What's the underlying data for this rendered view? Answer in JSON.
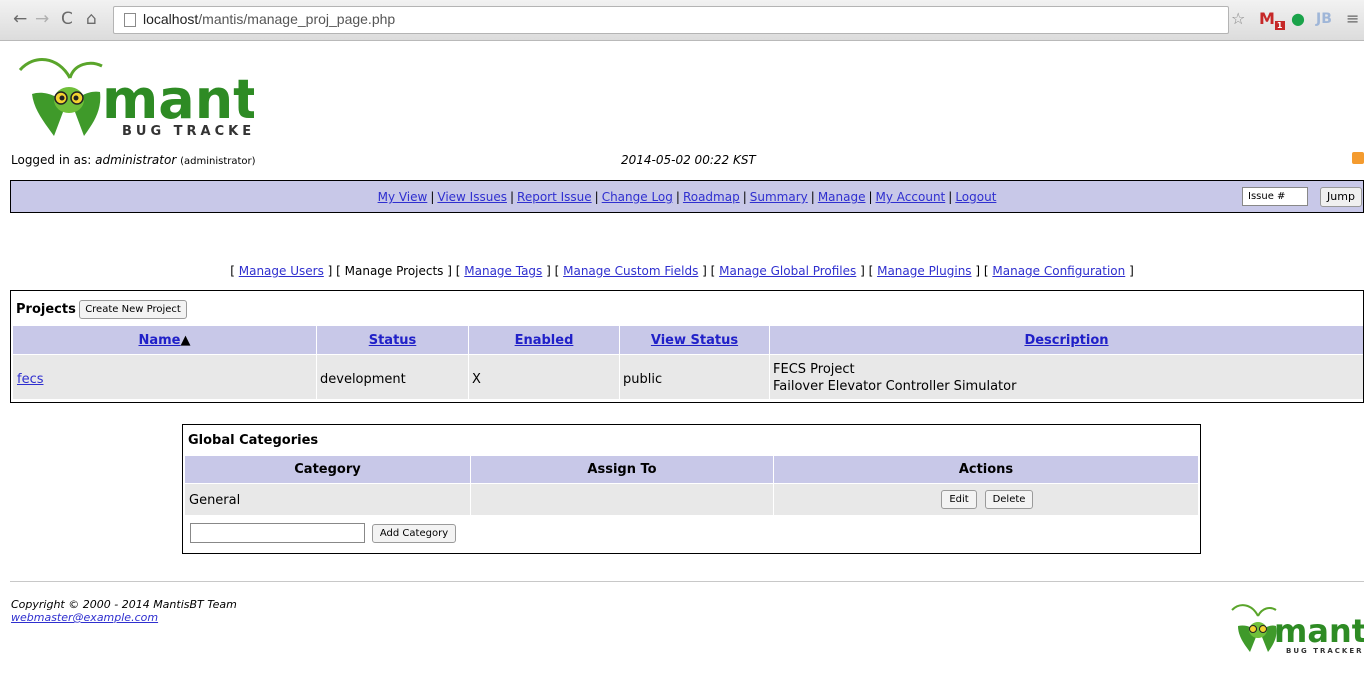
{
  "browser": {
    "url_host": "localhost",
    "url_path": "/mantis/manage_proj_page.php",
    "gmail_badge": "1"
  },
  "logo": {
    "wordmark": "mantis",
    "tagline": "BUG TRACKER"
  },
  "status_bar": {
    "logged_in_prefix": "Logged in as: ",
    "username": "administrator",
    "access_level": "(administrator)",
    "datetime": "2014-05-02 00:22 KST"
  },
  "main_menu": {
    "items": [
      "My View",
      "View Issues",
      "Report Issue",
      "Change Log",
      "Roadmap",
      "Summary",
      "Manage",
      "My Account",
      "Logout"
    ],
    "issue_placeholder": "Issue #",
    "jump_label": "Jump"
  },
  "manage_menu": {
    "items": [
      {
        "label": "Manage Users",
        "link": true
      },
      {
        "label": "Manage Projects",
        "link": false
      },
      {
        "label": "Manage Tags",
        "link": true
      },
      {
        "label": "Manage Custom Fields",
        "link": true
      },
      {
        "label": "Manage Global Profiles",
        "link": true
      },
      {
        "label": "Manage Plugins",
        "link": true
      },
      {
        "label": "Manage Configuration",
        "link": true
      }
    ]
  },
  "projects": {
    "title": "Projects",
    "create_button": "Create New Project",
    "columns": [
      "Name",
      "Status",
      "Enabled",
      "View Status",
      "Description"
    ],
    "sort_indicator": "▲",
    "rows": [
      {
        "name": "fecs",
        "status": "development",
        "enabled": "X",
        "view_status": "public",
        "description_line1": "FECS Project",
        "description_line2": "Failover Elevator Controller Simulator"
      }
    ]
  },
  "global_categories": {
    "title": "Global Categories",
    "columns": [
      "Category",
      "Assign To",
      "Actions"
    ],
    "rows": [
      {
        "category": "General",
        "assign_to": "",
        "edit_label": "Edit",
        "delete_label": "Delete"
      }
    ],
    "add_value": "",
    "add_button": "Add Category"
  },
  "footer": {
    "copyright": "Copyright © 2000 - 2014 MantisBT Team",
    "webmaster": "webmaster@example.com"
  },
  "colors": {
    "header_bg": "#c8c8e8",
    "row_bg": "#e8e8e8",
    "link": "#2f2fcf"
  }
}
